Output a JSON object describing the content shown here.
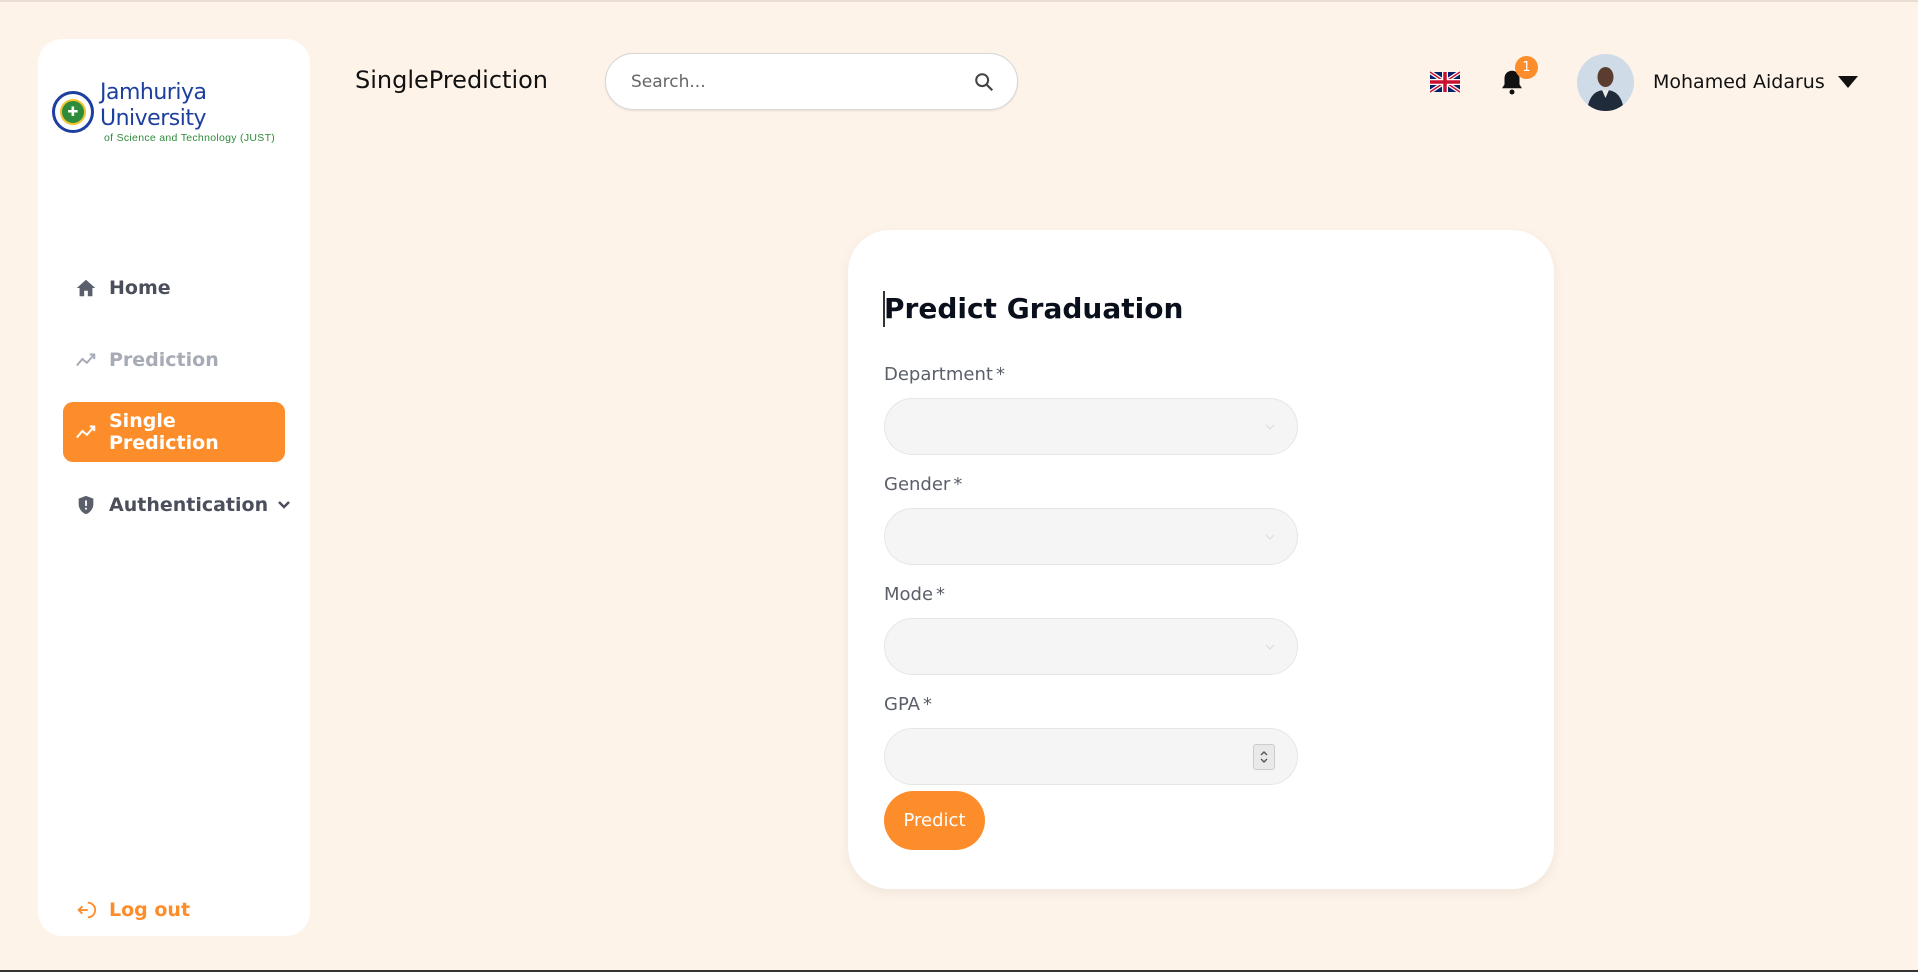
{
  "brand": {
    "name": "Jamhuriya University",
    "subtitle": "of Science and Technology (JUST)"
  },
  "sidebar": {
    "items": [
      {
        "label": "Home",
        "icon": "home-icon"
      },
      {
        "label": "Prediction",
        "icon": "trend-icon"
      },
      {
        "label": "Single Prediction",
        "icon": "trend-icon",
        "active": true
      },
      {
        "label": "Authentication",
        "icon": "shield-icon"
      }
    ],
    "logout": "Log out"
  },
  "header": {
    "title": "SinglePrediction",
    "search_placeholder": "Search...",
    "notification_count": "1",
    "user_name": "Mohamed Aidarus",
    "language_icon": "uk-flag-icon"
  },
  "form": {
    "title": "Predict Graduation",
    "fields": [
      {
        "label": "Department",
        "required": "*",
        "value": ""
      },
      {
        "label": "Gender",
        "required": "*",
        "value": ""
      },
      {
        "label": "Mode",
        "required": "*",
        "value": ""
      },
      {
        "label": "GPA",
        "required": "*",
        "value": ""
      }
    ],
    "submit": "Predict"
  },
  "colors": {
    "accent": "#fd8d2b",
    "background": "#fdf3e9",
    "brand_blue": "#1d3f9e",
    "brand_green": "#2e8b3a"
  }
}
